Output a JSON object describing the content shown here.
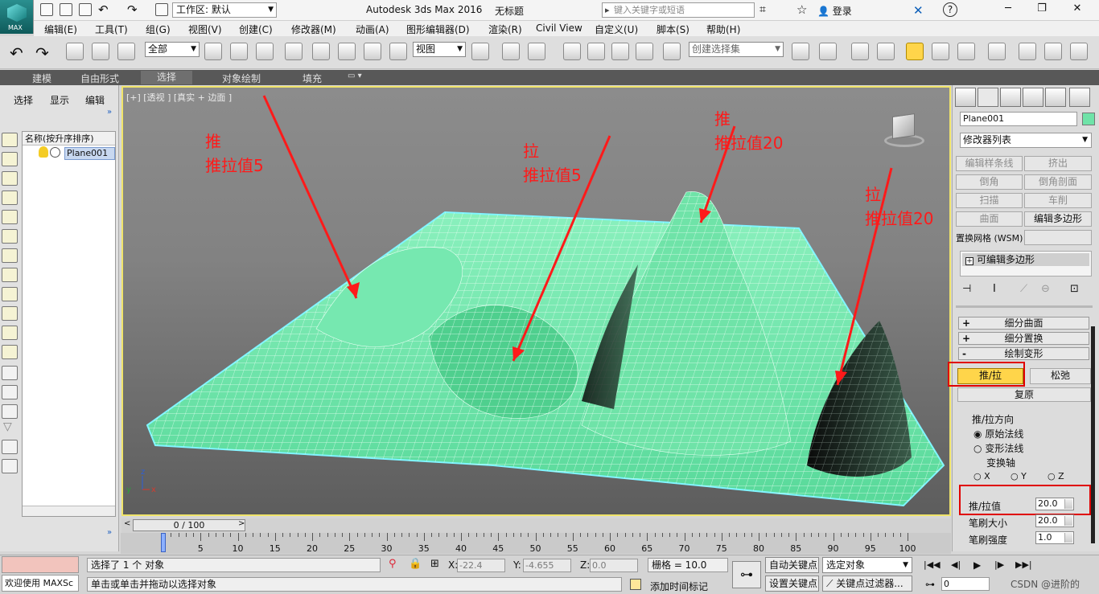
{
  "app": {
    "title": "Autodesk 3ds Max 2016",
    "document": "无标题",
    "logo_label": "MAX",
    "workspace_label": "工作区: 默认",
    "search_placeholder": "键入关键字或短语",
    "login_label": "登录"
  },
  "menu": [
    "编辑(E)",
    "工具(T)",
    "组(G)",
    "视图(V)",
    "创建(C)",
    "修改器(M)",
    "动画(A)",
    "图形编辑器(D)",
    "渲染(R)",
    "Civil View",
    "自定义(U)",
    "脚本(S)",
    "帮助(H)"
  ],
  "toolbar": {
    "filter_value": "全部",
    "ref_coord_value": "视图",
    "selection_set_placeholder": "创建选择集"
  },
  "ribbon_tabs": [
    {
      "label": "建模",
      "active": false
    },
    {
      "label": "自由形式",
      "active": false
    },
    {
      "label": "选择",
      "active": true
    },
    {
      "label": "对象绘制",
      "active": false
    },
    {
      "label": "填充",
      "active": false
    }
  ],
  "scene_explorer": {
    "tabs": [
      "选择",
      "显示",
      "编辑"
    ],
    "column_header": "名称(按升序排序)",
    "items": [
      {
        "name": "Plane001"
      }
    ]
  },
  "viewport": {
    "label": "[+] [透视 ] [真实 + 边面 ]",
    "annotations": [
      {
        "line1": "推",
        "line2": "推拉值5"
      },
      {
        "line1": "拉",
        "line2": "推拉值5"
      },
      {
        "line1": "推",
        "line2": "推拉值20"
      },
      {
        "line1": "拉",
        "line2": "推拉值20"
      }
    ],
    "gizmo_axes": [
      "z",
      "x",
      "y"
    ],
    "accent_color": "#ff1a1a",
    "mesh_color": "#6fe3a8"
  },
  "command_panel": {
    "object_name": "Plane001",
    "modifier_list": "修改器列表",
    "buttons": [
      {
        "label": "编辑样条线",
        "enabled": false
      },
      {
        "label": "挤出",
        "enabled": false
      },
      {
        "label": "倒角",
        "enabled": false
      },
      {
        "label": "倒角剖面",
        "enabled": false
      },
      {
        "label": "扫描",
        "enabled": false
      },
      {
        "label": "车削",
        "enabled": false
      },
      {
        "label": "曲面",
        "enabled": false
      },
      {
        "label": "编辑多边形",
        "enabled": true
      }
    ],
    "remesh_label": "置换网格 (WSM)",
    "stack_item": "可编辑多边形",
    "rollouts": [
      {
        "sign": "+",
        "label": "细分曲面"
      },
      {
        "sign": "+",
        "label": "细分置换"
      },
      {
        "sign": "-",
        "label": "绘制变形"
      }
    ],
    "paint": {
      "push_pull_label": "推/拉",
      "relax_label": "松弛",
      "revert_label": "复原",
      "direction_group": "推/拉方向",
      "options": [
        {
          "label": "原始法线",
          "checked": true
        },
        {
          "label": "变形法线",
          "checked": false
        },
        {
          "label": "变换轴",
          "checked": false
        }
      ],
      "axes": [
        "X",
        "Y",
        "Z"
      ],
      "push_pull_value_label": "推/拉值",
      "push_pull_value": "20.0",
      "brush_size_label": "笔刷大小",
      "brush_size": "20.0",
      "brush_strength_label": "笔刷强度",
      "brush_strength": "1.0"
    }
  },
  "timeline": {
    "frame_label": "0 / 100",
    "ticks": [
      0,
      5,
      10,
      15,
      20,
      25,
      30,
      35,
      40,
      45,
      50,
      55,
      60,
      65,
      70,
      75,
      80,
      85,
      90,
      95,
      100
    ]
  },
  "status": {
    "maxscript": "欢迎使用 MAXSc",
    "selection_msg": "选择了 1 个 对象",
    "prompt_msg": "单击或单击并拖动以选择对象",
    "x_label": "X:",
    "x_value": "-22.4",
    "y_label": "Y:",
    "y_value": "-4.655",
    "z_label": "Z:",
    "z_value": "0.0",
    "grid_label": "栅格 = 10.0",
    "add_time_tag": "添加时间标记",
    "auto_key": "自动关键点",
    "set_key": "设置关键点",
    "key_mode_value": "选定对象",
    "key_filters": "关键点过滤器...",
    "frame_value": "0",
    "watermark": "CSDN @进阶的"
  }
}
